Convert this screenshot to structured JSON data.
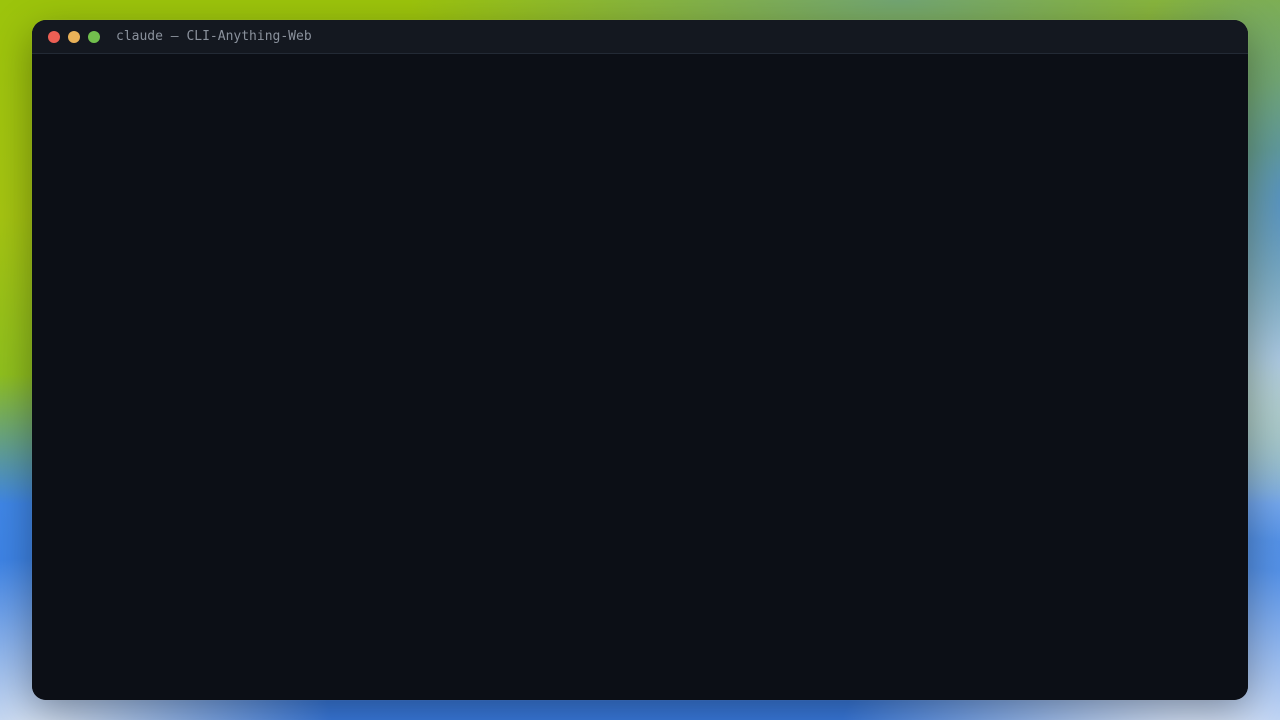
{
  "window": {
    "title": "claude — CLI-Anything-Web",
    "controls": {
      "close": {
        "icon": "close-dot-icon",
        "color": "#ec5f54"
      },
      "minimize": {
        "icon": "minimize-dot-icon",
        "color": "#e9b158"
      },
      "maximize": {
        "icon": "maximize-dot-icon",
        "color": "#72c04d"
      }
    }
  },
  "terminal": {
    "background": "#0c0f16",
    "content": ""
  }
}
